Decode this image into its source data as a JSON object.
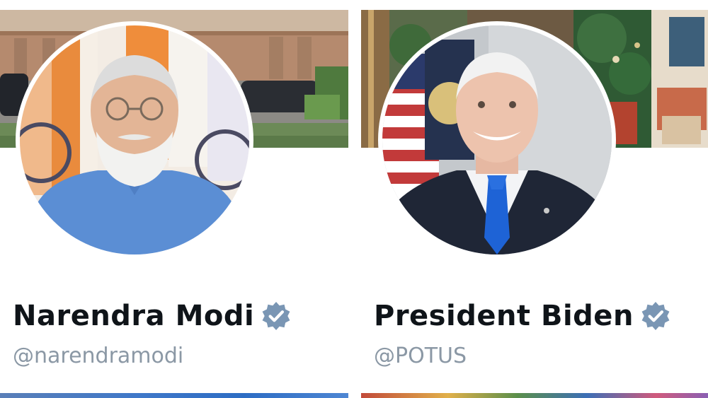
{
  "profiles": [
    {
      "name": "Narendra Modi",
      "handle": "@narendramodi",
      "verified_icon": "verified-badge-icon",
      "badge_color": "#7a96b4"
    },
    {
      "name": "President Biden",
      "handle": "@POTUS",
      "verified_icon": "verified-badge-icon",
      "badge_color": "#7a96b4"
    }
  ],
  "colors": {
    "name_text": "#0f1419",
    "handle_text": "#8b98a5",
    "background": "#ffffff"
  }
}
